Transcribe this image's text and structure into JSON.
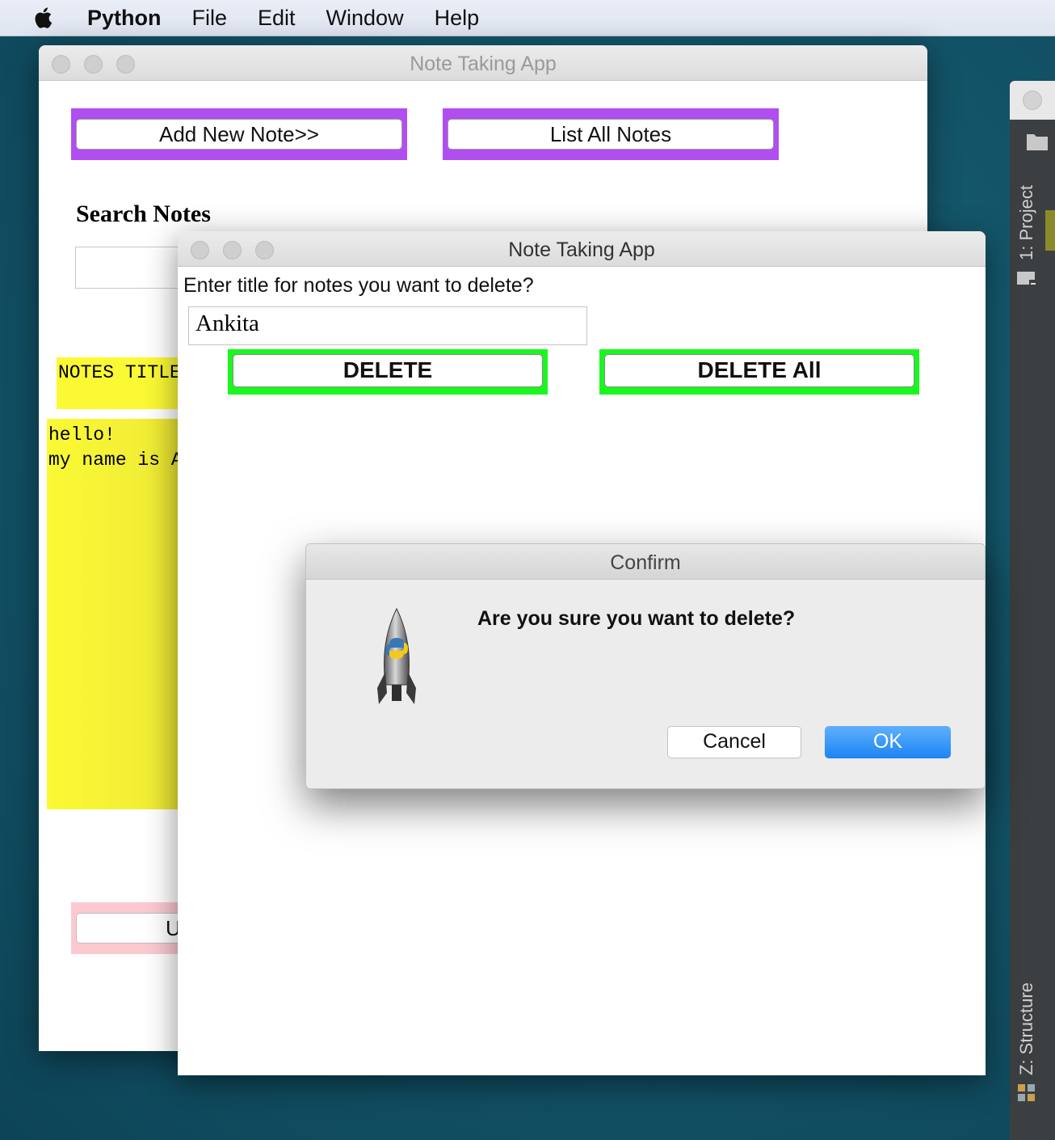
{
  "menubar": {
    "app_name": "Python",
    "items": [
      "File",
      "Edit",
      "Window",
      "Help"
    ]
  },
  "main_window": {
    "title": "Note Taking App",
    "add_note_label": "Add New Note>>",
    "list_notes_label": "List All Notes",
    "search_label": "Search Notes",
    "search_value": "",
    "notes_title_label": "NOTES TITLE",
    "note_lines": [
      "hello!",
      "my name is A"
    ],
    "update_button_partial": "U",
    "colors": {
      "purple": "#b04ef0",
      "yellow": "#fbf934",
      "pink": "#fcc9d1"
    }
  },
  "delete_window": {
    "title": "Note Taking App",
    "prompt": "Enter title for notes you want to delete?",
    "title_input_value": "Ankita",
    "delete_label": "DELETE",
    "delete_all_label": "DELETE All",
    "colors": {
      "green": "#19f71e"
    }
  },
  "confirm_dialog": {
    "title": "Confirm",
    "message": "Are you sure you want to delete?",
    "cancel_label": "Cancel",
    "ok_label": "OK",
    "icon": "python-launcher-rocket-icon"
  },
  "ide_sidebar": {
    "project_tab": "1: Project",
    "structure_tab": "Z: Structure"
  }
}
